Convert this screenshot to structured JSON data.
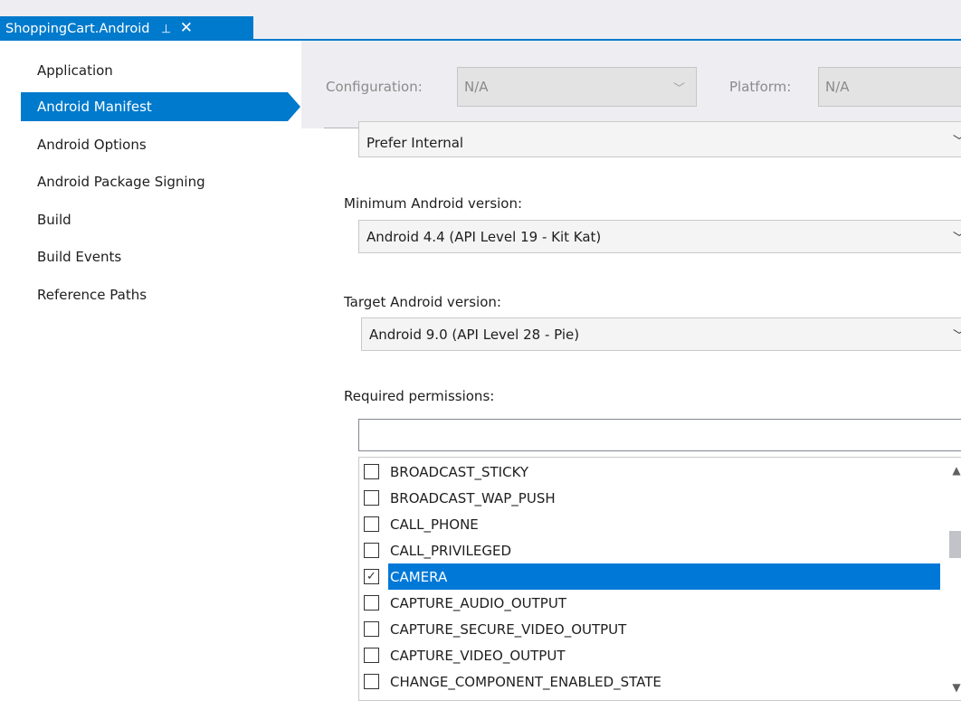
{
  "tab": {
    "title": "ShoppingCart.Android",
    "pin_glyph": "⊣",
    "close_glyph": "✕"
  },
  "nav": {
    "items": [
      {
        "label": "Application",
        "selected": false
      },
      {
        "label": "Android Manifest",
        "selected": true
      },
      {
        "label": "Android Options",
        "selected": false
      },
      {
        "label": "Android Package Signing",
        "selected": false
      },
      {
        "label": "Build",
        "selected": false
      },
      {
        "label": "Build Events",
        "selected": false
      },
      {
        "label": "Reference Paths",
        "selected": false
      }
    ]
  },
  "config": {
    "configuration_label": "Configuration:",
    "configuration_value": "N/A",
    "platform_label": "Platform:",
    "platform_value": "N/A"
  },
  "install_location": {
    "value": "Prefer Internal"
  },
  "min_android": {
    "label": "Minimum Android version:",
    "value": "Android 4.4 (API Level 19 - Kit Kat)"
  },
  "target_android": {
    "label": "Target Android version:",
    "value": "Android 9.0 (API Level 28 - Pie)"
  },
  "permissions": {
    "label": "Required permissions:",
    "search_value": "",
    "items": [
      {
        "label": "BROADCAST_STICKY",
        "checked": false,
        "selected": false
      },
      {
        "label": "BROADCAST_WAP_PUSH",
        "checked": false,
        "selected": false
      },
      {
        "label": "CALL_PHONE",
        "checked": false,
        "selected": false
      },
      {
        "label": "CALL_PRIVILEGED",
        "checked": false,
        "selected": false
      },
      {
        "label": "CAMERA",
        "checked": true,
        "selected": true
      },
      {
        "label": "CAPTURE_AUDIO_OUTPUT",
        "checked": false,
        "selected": false
      },
      {
        "label": "CAPTURE_SECURE_VIDEO_OUTPUT",
        "checked": false,
        "selected": false
      },
      {
        "label": "CAPTURE_VIDEO_OUTPUT",
        "checked": false,
        "selected": false
      },
      {
        "label": "CHANGE_COMPONENT_ENABLED_STATE",
        "checked": false,
        "selected": false
      }
    ]
  },
  "colors": {
    "accent": "#007acc",
    "selection": "#0078d7",
    "chrome_background": "#eeeef2"
  }
}
